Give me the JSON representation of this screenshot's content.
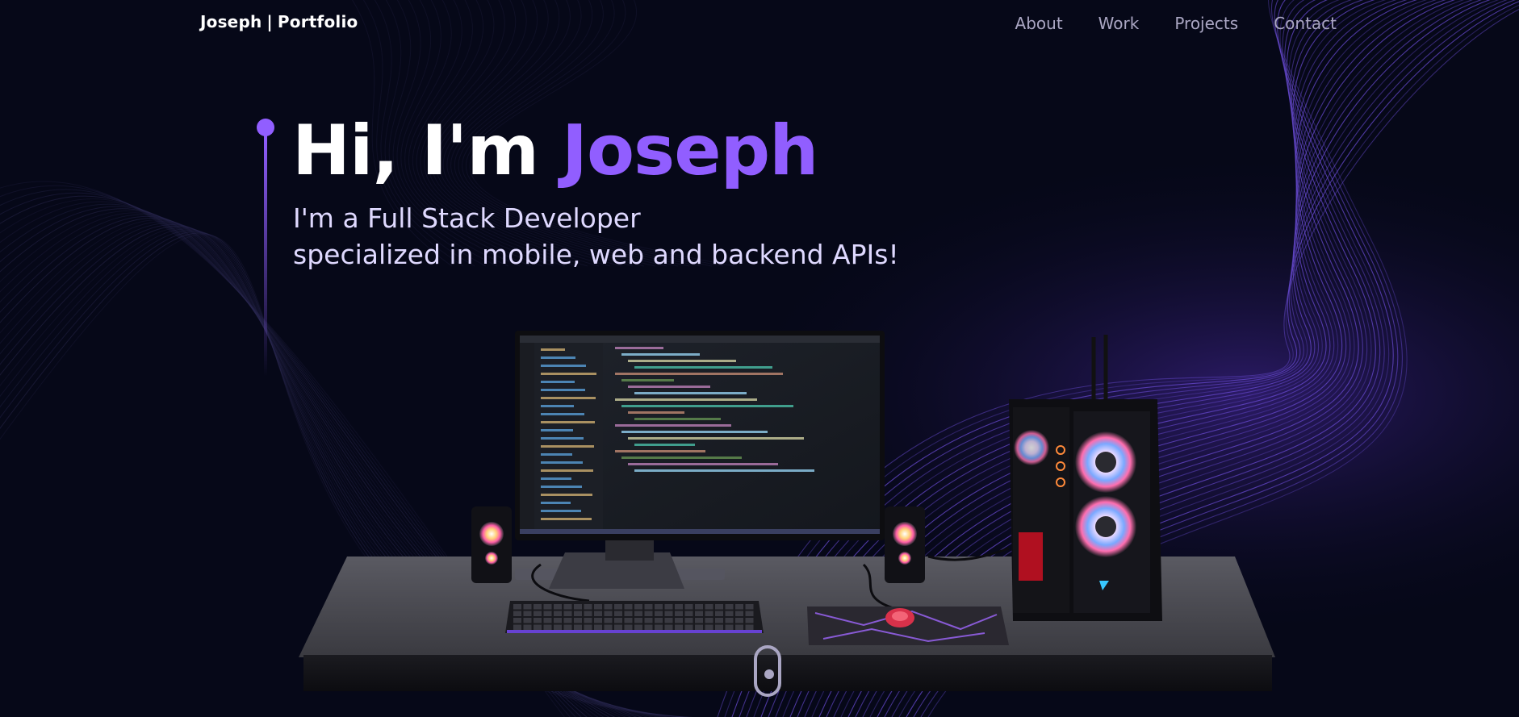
{
  "nav": {
    "logo_name": "Joseph",
    "logo_separator": "|",
    "logo_suffix": "Portfolio",
    "links": [
      "About",
      "Work",
      "Projects",
      "Contact"
    ]
  },
  "hero": {
    "greeting": "Hi, I'm",
    "name": "Joseph",
    "subtitle_line1": "I'm a Full Stack Developer",
    "subtitle_line2": "specialized in mobile, web and backend APIs!"
  },
  "colors": {
    "background": "#060818",
    "accent": "#915eff",
    "nav_text": "#aaa6c3",
    "text": "#ffffff"
  },
  "icons": [
    "scroll-indicator-icon"
  ]
}
